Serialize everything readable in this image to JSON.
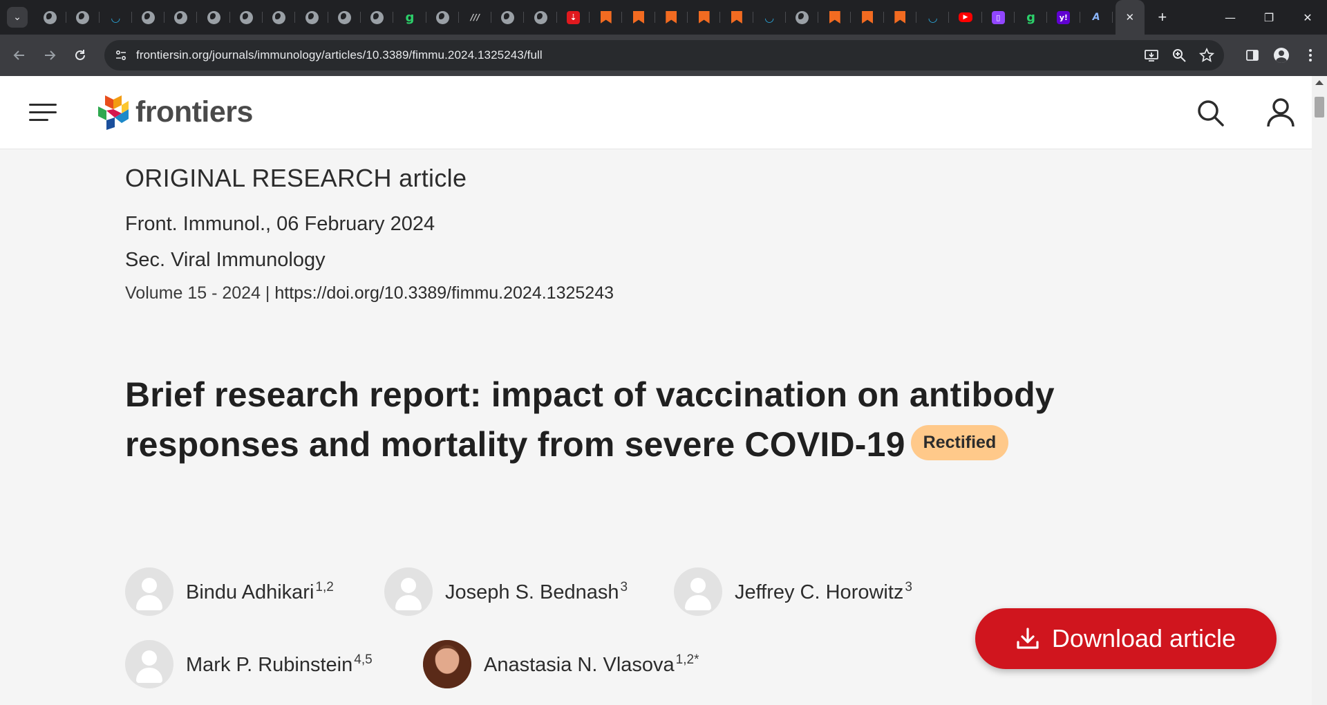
{
  "browser": {
    "tab_search_glyph": "⌄",
    "tabs": [
      {
        "icon": "globe-icon"
      },
      {
        "icon": "globe-icon"
      },
      {
        "icon": "shield-icon"
      },
      {
        "icon": "globe-icon"
      },
      {
        "icon": "globe-icon"
      },
      {
        "icon": "globe-icon"
      },
      {
        "icon": "globe-icon"
      },
      {
        "icon": "globe-icon"
      },
      {
        "icon": "globe-icon"
      },
      {
        "icon": "globe-icon"
      },
      {
        "icon": "globe-icon"
      },
      {
        "icon": "g-icon"
      },
      {
        "icon": "globe-icon"
      },
      {
        "icon": "w-icon"
      },
      {
        "icon": "globe-icon"
      },
      {
        "icon": "globe-icon"
      },
      {
        "icon": "red-app-icon"
      },
      {
        "icon": "bookmark-icon"
      },
      {
        "icon": "bookmark-icon"
      },
      {
        "icon": "bookmark-icon"
      },
      {
        "icon": "bookmark-icon"
      },
      {
        "icon": "bookmark-icon"
      },
      {
        "icon": "shield-icon"
      },
      {
        "icon": "globe-icon"
      },
      {
        "icon": "bookmark-icon"
      },
      {
        "icon": "bookmark-icon"
      },
      {
        "icon": "bookmark-icon"
      },
      {
        "icon": "shield-icon"
      },
      {
        "icon": "youtube-icon"
      },
      {
        "icon": "twitch-icon"
      },
      {
        "icon": "g-icon"
      },
      {
        "icon": "yahoo-icon"
      },
      {
        "icon": "a-icon"
      }
    ],
    "active_tab_close": "✕",
    "new_tab": "+",
    "window_controls": {
      "minimize": "—",
      "restore": "❐",
      "close": "✕"
    },
    "url": "frontiersin.org/journals/immunology/articles/10.3389/fimmu.2024.1325243/full"
  },
  "site": {
    "logo_text": "frontiers"
  },
  "article": {
    "type": "ORIGINAL RESEARCH article",
    "journal_date": "Front. Immunol., 06 February 2024",
    "section": "Sec. Viral Immunology",
    "volume": "Volume 15 - 2024 |",
    "doi": "https://doi.org/10.3389/fimmu.2024.1325243",
    "title": "Brief research report: impact of vaccination on antibody responses and mortality from severe COVID-19",
    "badge": "Rectified",
    "authors": [
      {
        "name": "Bindu Adhikari",
        "aff": "1,2",
        "photo": false
      },
      {
        "name": "Joseph S. Bednash",
        "aff": "3",
        "photo": false
      },
      {
        "name": "Jeffrey C. Horowitz",
        "aff": "3",
        "photo": false
      },
      {
        "name": "Mark P. Rubinstein",
        "aff": "4,5",
        "photo": false
      },
      {
        "name": "Anastasia N. Vlasova",
        "aff": "1,2*",
        "photo": true
      }
    ]
  },
  "download": {
    "label": "Download article"
  },
  "colors": {
    "brand_red": "#d0151e",
    "badge": "#ffc98a",
    "page_bg": "#f5f5f5"
  }
}
